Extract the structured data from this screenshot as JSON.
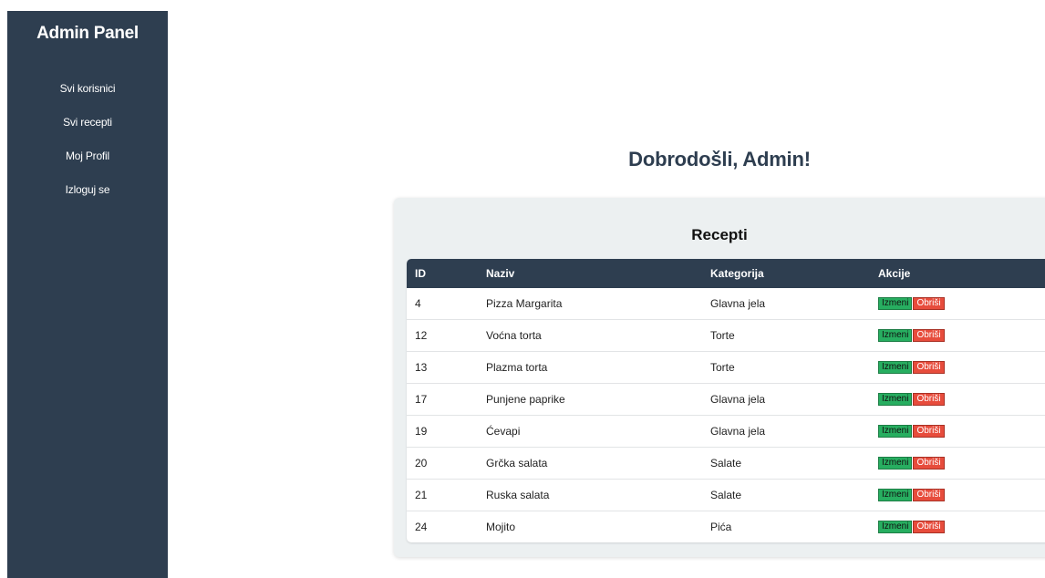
{
  "sidebar": {
    "title": "Admin Panel",
    "items": [
      {
        "label": "Svi korisnici"
      },
      {
        "label": "Svi recepti"
      },
      {
        "label": "Moj Profil"
      },
      {
        "label": "Izloguj se"
      }
    ]
  },
  "main": {
    "welcome": "Dobrodošli, Admin!",
    "panel_title": "Recepti",
    "table": {
      "headers": [
        "ID",
        "Naziv",
        "Kategorija",
        "Akcije"
      ],
      "edit_label": "Izmeni",
      "delete_label": "Obriši",
      "rows": [
        {
          "id": "4",
          "naziv": "Pizza Margarita",
          "kategorija": "Glavna jela"
        },
        {
          "id": "12",
          "naziv": "Voćna torta",
          "kategorija": "Torte"
        },
        {
          "id": "13",
          "naziv": "Plazma torta",
          "kategorija": "Torte"
        },
        {
          "id": "17",
          "naziv": "Punjene paprike",
          "kategorija": "Glavna jela"
        },
        {
          "id": "19",
          "naziv": "Ćevapi",
          "kategorija": "Glavna jela"
        },
        {
          "id": "20",
          "naziv": "Grčka salata",
          "kategorija": "Salate"
        },
        {
          "id": "21",
          "naziv": "Ruska salata",
          "kategorija": "Salate"
        },
        {
          "id": "24",
          "naziv": "Mojito",
          "kategorija": "Pića"
        }
      ]
    }
  },
  "colors": {
    "sidebar_bg": "#2e3e50",
    "edit_button": "#27ae60",
    "delete_button": "#e74c3c",
    "panel_bg": "#ecf0f1"
  }
}
